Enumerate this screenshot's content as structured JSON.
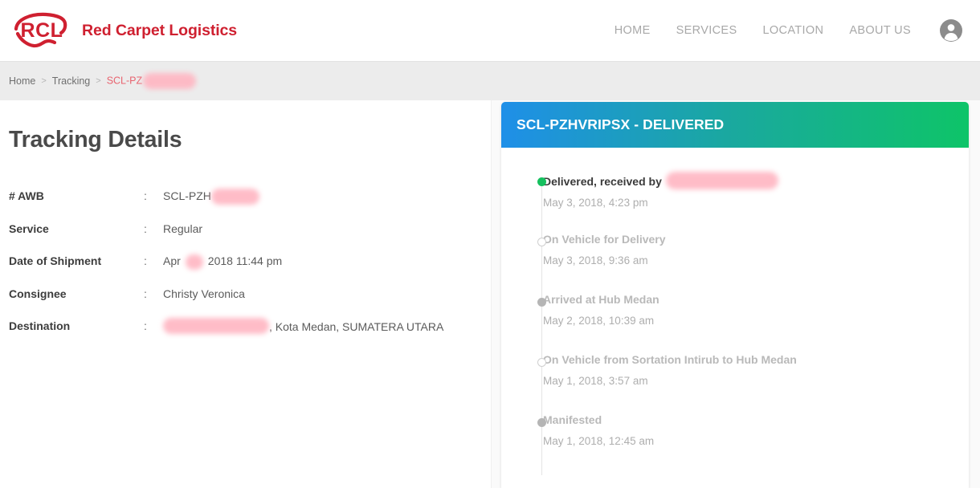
{
  "header": {
    "brand_name": "Red Carpet Logistics",
    "logo_alt": "RCL",
    "nav": [
      {
        "label": "HOME"
      },
      {
        "label": "SERVICES"
      },
      {
        "label": "LOCATION"
      },
      {
        "label": "ABOUT US"
      }
    ],
    "account_icon": "account-circle-icon"
  },
  "breadcrumb": {
    "items": [
      {
        "label": "Home"
      },
      {
        "label": "Tracking"
      }
    ],
    "separator": ">",
    "current": "SCL-PZ",
    "current_redacted": true
  },
  "left": {
    "title": "Tracking Details",
    "rows": [
      {
        "label": "# AWB",
        "colon": ":",
        "value": "SCL-PZH",
        "redacted_after": true,
        "redact_width": 60
      },
      {
        "label": "Service",
        "colon": ":",
        "value": "Regular",
        "redacted_after": false,
        "redact_width": 0
      },
      {
        "label": "Date of Shipment",
        "colon": ":",
        "value_before": "Apr",
        "value_after": "2018 11:44 pm",
        "redacted_mid": true,
        "redact_width": 22
      },
      {
        "label": "Consignee",
        "colon": ":",
        "value": "Christy Veronica",
        "redacted_after": false,
        "redact_width": 0
      },
      {
        "label": "Destination",
        "colon": ":",
        "value_before": "",
        "value_after": ", Kota Medan, SUMATERA UTARA",
        "redacted_lead": true,
        "redact_width": 132
      }
    ]
  },
  "card": {
    "title": "SCL-PZHVRIPSX - DELIVERED",
    "gradient_from": "#1f8fe8",
    "gradient_to": "#0ec468",
    "timeline": [
      {
        "status_prefix": "Delivered, received by",
        "redacted_name": true,
        "redact_width": 140,
        "time": "May 3, 2018, 4:23 pm",
        "marker": "filled-green",
        "state": "active"
      },
      {
        "status_prefix": "On Vehicle for Delivery",
        "redacted_name": false,
        "redact_width": 0,
        "time": "May 3, 2018, 9:36 am",
        "marker": "hollow",
        "state": "past"
      },
      {
        "status_prefix": "Arrived at Hub Medan",
        "redacted_name": false,
        "redact_width": 0,
        "time": "May 2, 2018, 10:39 am",
        "marker": "filled-gray",
        "state": "past"
      },
      {
        "status_prefix": "On Vehicle from Sortation Intirub to Hub Medan",
        "redacted_name": false,
        "redact_width": 0,
        "time": "May 1, 2018, 3:57 am",
        "marker": "hollow",
        "state": "past"
      },
      {
        "status_prefix": "Manifested",
        "redacted_name": false,
        "redact_width": 0,
        "time": "May 1, 2018, 12:45 am",
        "marker": "filled-gray",
        "state": "past"
      }
    ]
  },
  "colors": {
    "brand_red": "#cf2030",
    "accent_blue": "#1f8fe8",
    "accent_green": "#0ec468",
    "redaction_pink": "#ffb7c3"
  }
}
